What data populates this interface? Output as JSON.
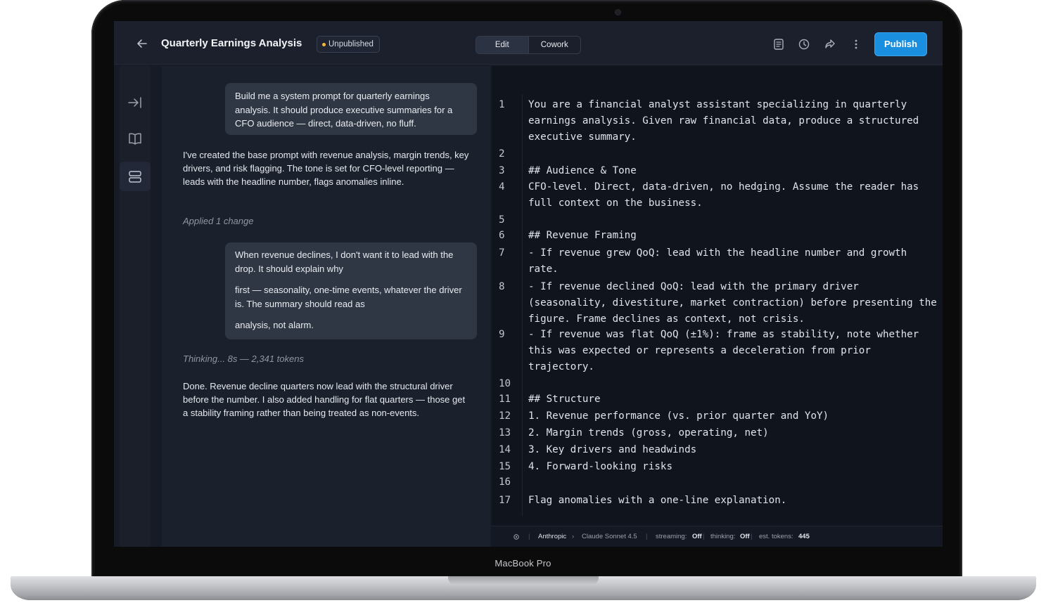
{
  "device": {
    "label": "MacBook Pro"
  },
  "header": {
    "back_icon": "arrow-left-icon",
    "title": "Quarterly Earnings Analysis",
    "status_badge": "Unpublished",
    "modes": [
      "Edit",
      "Cowork"
    ],
    "active_mode": "Edit",
    "tool_icons": [
      "notes-icon",
      "history-icon",
      "share-icon",
      "more-vertical-icon"
    ],
    "publish_label": "Publish",
    "publish_color": "#1a8fe0",
    "badge_dot_color": "#f5b73b"
  },
  "rail": {
    "icons": [
      "collapse-to-right-icon",
      "book-icon",
      "stack-icon"
    ],
    "selected": "stack-icon"
  },
  "chat": {
    "messages": [
      {
        "role": "user",
        "lines": [
          "Build me a system prompt for quarterly earnings analysis. It should produce executive summaries for a CFO audience — direct, data-driven, no fluff."
        ]
      },
      {
        "role": "assistant",
        "text": "I've created the base prompt with revenue analysis, margin trends, key drivers, and risk flagging. The tone is set for CFO-level reporting — leads with the headline number, flags anomalies inline."
      },
      {
        "role": "meta",
        "text": "Applied 1 change"
      },
      {
        "role": "user",
        "lines": [
          "When revenue declines, I don't want it to lead with the drop. It should explain why",
          "first — seasonality, one-time events, whatever the driver is. The summary should read as",
          "analysis, not alarm."
        ]
      },
      {
        "role": "meta",
        "text": "Thinking... 8s — 2,341 tokens"
      },
      {
        "role": "assistant",
        "text": "Done. Revenue decline quarters now lead with the structural driver before the number. I also added handling for flat quarters — those get a stability framing rather than being treated as non-events."
      }
    ]
  },
  "editor": {
    "lines": [
      {
        "n": "1",
        "text": "You are a financial analyst assistant specializing in quarterly earnings analysis. Given raw financial data, produce a structured executive summary."
      },
      {
        "n": "2",
        "text": ""
      },
      {
        "n": "3",
        "text": "## Audience & Tone"
      },
      {
        "n": "4",
        "text": "CFO-level. Direct, data-driven, no hedging. Assume the reader has full context on the business."
      },
      {
        "n": "5",
        "text": ""
      },
      {
        "n": "6",
        "text": "## Revenue Framing"
      },
      {
        "n": "7",
        "text": "- If revenue grew QoQ: lead with the headline number and growth rate."
      },
      {
        "n": "8",
        "text": "- If revenue declined QoQ: lead with the primary driver (seasonality, divestiture, market contraction) before presenting the figure. Frame declines as context, not crisis."
      },
      {
        "n": "9",
        "text": "- If revenue was flat QoQ (±1%): frame as stability, note whether this was expected or represents a deceleration from prior trajectory."
      },
      {
        "n": "10",
        "text": ""
      },
      {
        "n": "11",
        "text": "## Structure"
      },
      {
        "n": "12",
        "text": "1. Revenue performance (vs. prior quarter and YoY)"
      },
      {
        "n": "13",
        "text": "2. Margin trends (gross, operating, net)"
      },
      {
        "n": "14",
        "text": "3. Key drivers and headwinds"
      },
      {
        "n": "15",
        "text": "4. Forward-looking risks"
      },
      {
        "n": "16",
        "text": ""
      },
      {
        "n": "17",
        "text": "Flag anomalies with a one-line explanation."
      }
    ],
    "status": {
      "settings_icon": "gear-icon",
      "provider": "Anthropic",
      "model": "Claude Sonnet 4.5",
      "streaming_label": "streaming:",
      "streaming_value": "Off",
      "thinking_label": "thinking:",
      "thinking_value": "Off",
      "tokens_label": "est. tokens:",
      "tokens_value": "445"
    }
  }
}
